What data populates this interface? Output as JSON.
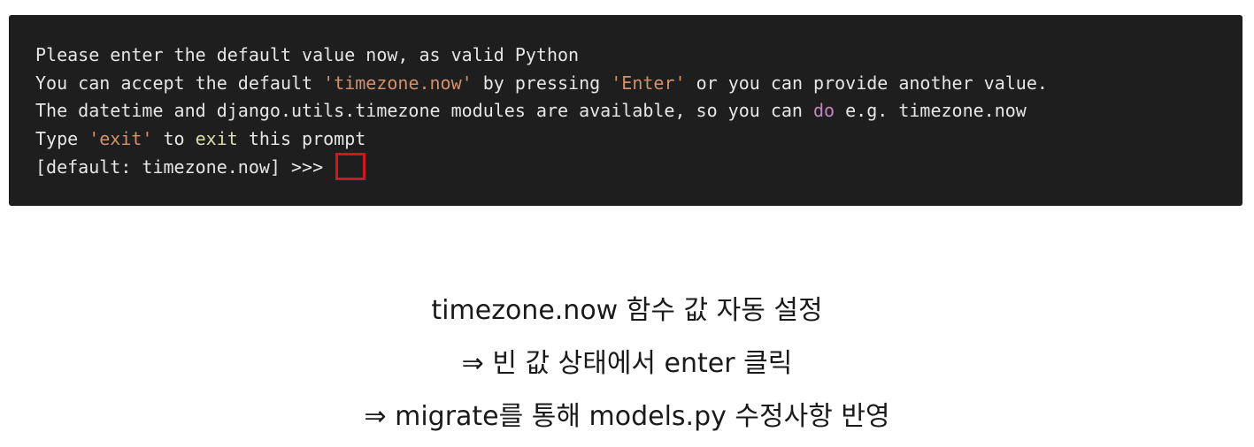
{
  "terminal": {
    "line1": "Please enter the default value now, as valid Python",
    "line2": {
      "t1": "You can accept the default ",
      "s1": "'timezone.now'",
      "t2": " by pressing ",
      "s2": "'Enter'",
      "t3": " or you can provide another value."
    },
    "line3": {
      "t1": "The datetime and django.utils.timezone modules are available, so you can ",
      "k1": "do",
      "t2": " e.g. timezone.now"
    },
    "line4": {
      "t1": "Type ",
      "s1": "'exit'",
      "t2": " to ",
      "k1": "exit",
      "t3": " this prompt"
    },
    "line5": {
      "prompt": "[default: timezone.now] >>> "
    }
  },
  "captions": {
    "line1": "timezone.now 함수 값 자동 설정",
    "line2": "⇒ 빈 값 상태에서 enter 클릭",
    "line3": "⇒ migrate를 통해 models.py 수정사항 반영"
  },
  "colors": {
    "terminal_bg": "#1e1e1e",
    "text": "#e6e6e6",
    "string": "#d4906a",
    "keyword_yellow": "#dcdcaa",
    "keyword_purple": "#c586c0",
    "highlight_box": "#d0181c"
  }
}
